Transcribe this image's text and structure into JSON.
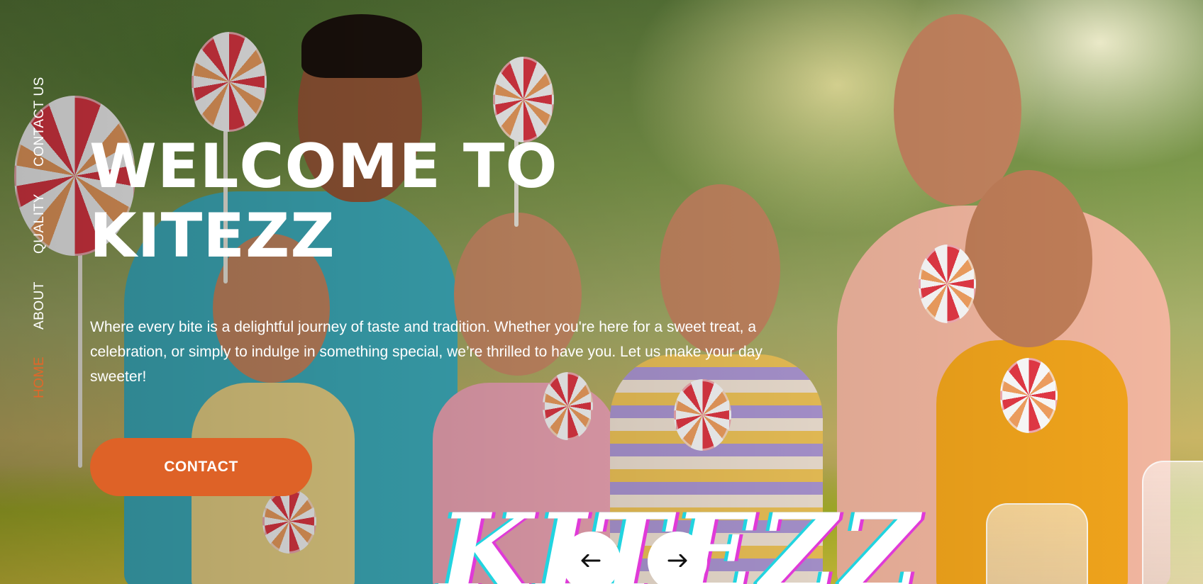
{
  "nav": {
    "items": [
      {
        "label": "HOME",
        "active": true
      },
      {
        "label": "ABOUT",
        "active": false
      },
      {
        "label": "QUALITY",
        "active": false
      },
      {
        "label": "CONTACT US",
        "active": false
      }
    ]
  },
  "hero": {
    "title_line1": "WELCOME TO",
    "title_line2": "KITEZZ",
    "subtitle": "Where every bite is a delightful journey of taste and tradition. Whether you're here for a sweet treat, a celebration, or simply to indulge in something special, we’re thrilled to have you. Let us make your day sweeter!",
    "cta_label": "CONTACT",
    "brand_mark": "KITEZZ"
  },
  "carousel": {
    "prev_icon": "arrow-left-icon",
    "next_icon": "arrow-right-icon"
  },
  "colors": {
    "accent": "#de6227",
    "nav_active": "#e0672a",
    "text": "#ffffff"
  }
}
